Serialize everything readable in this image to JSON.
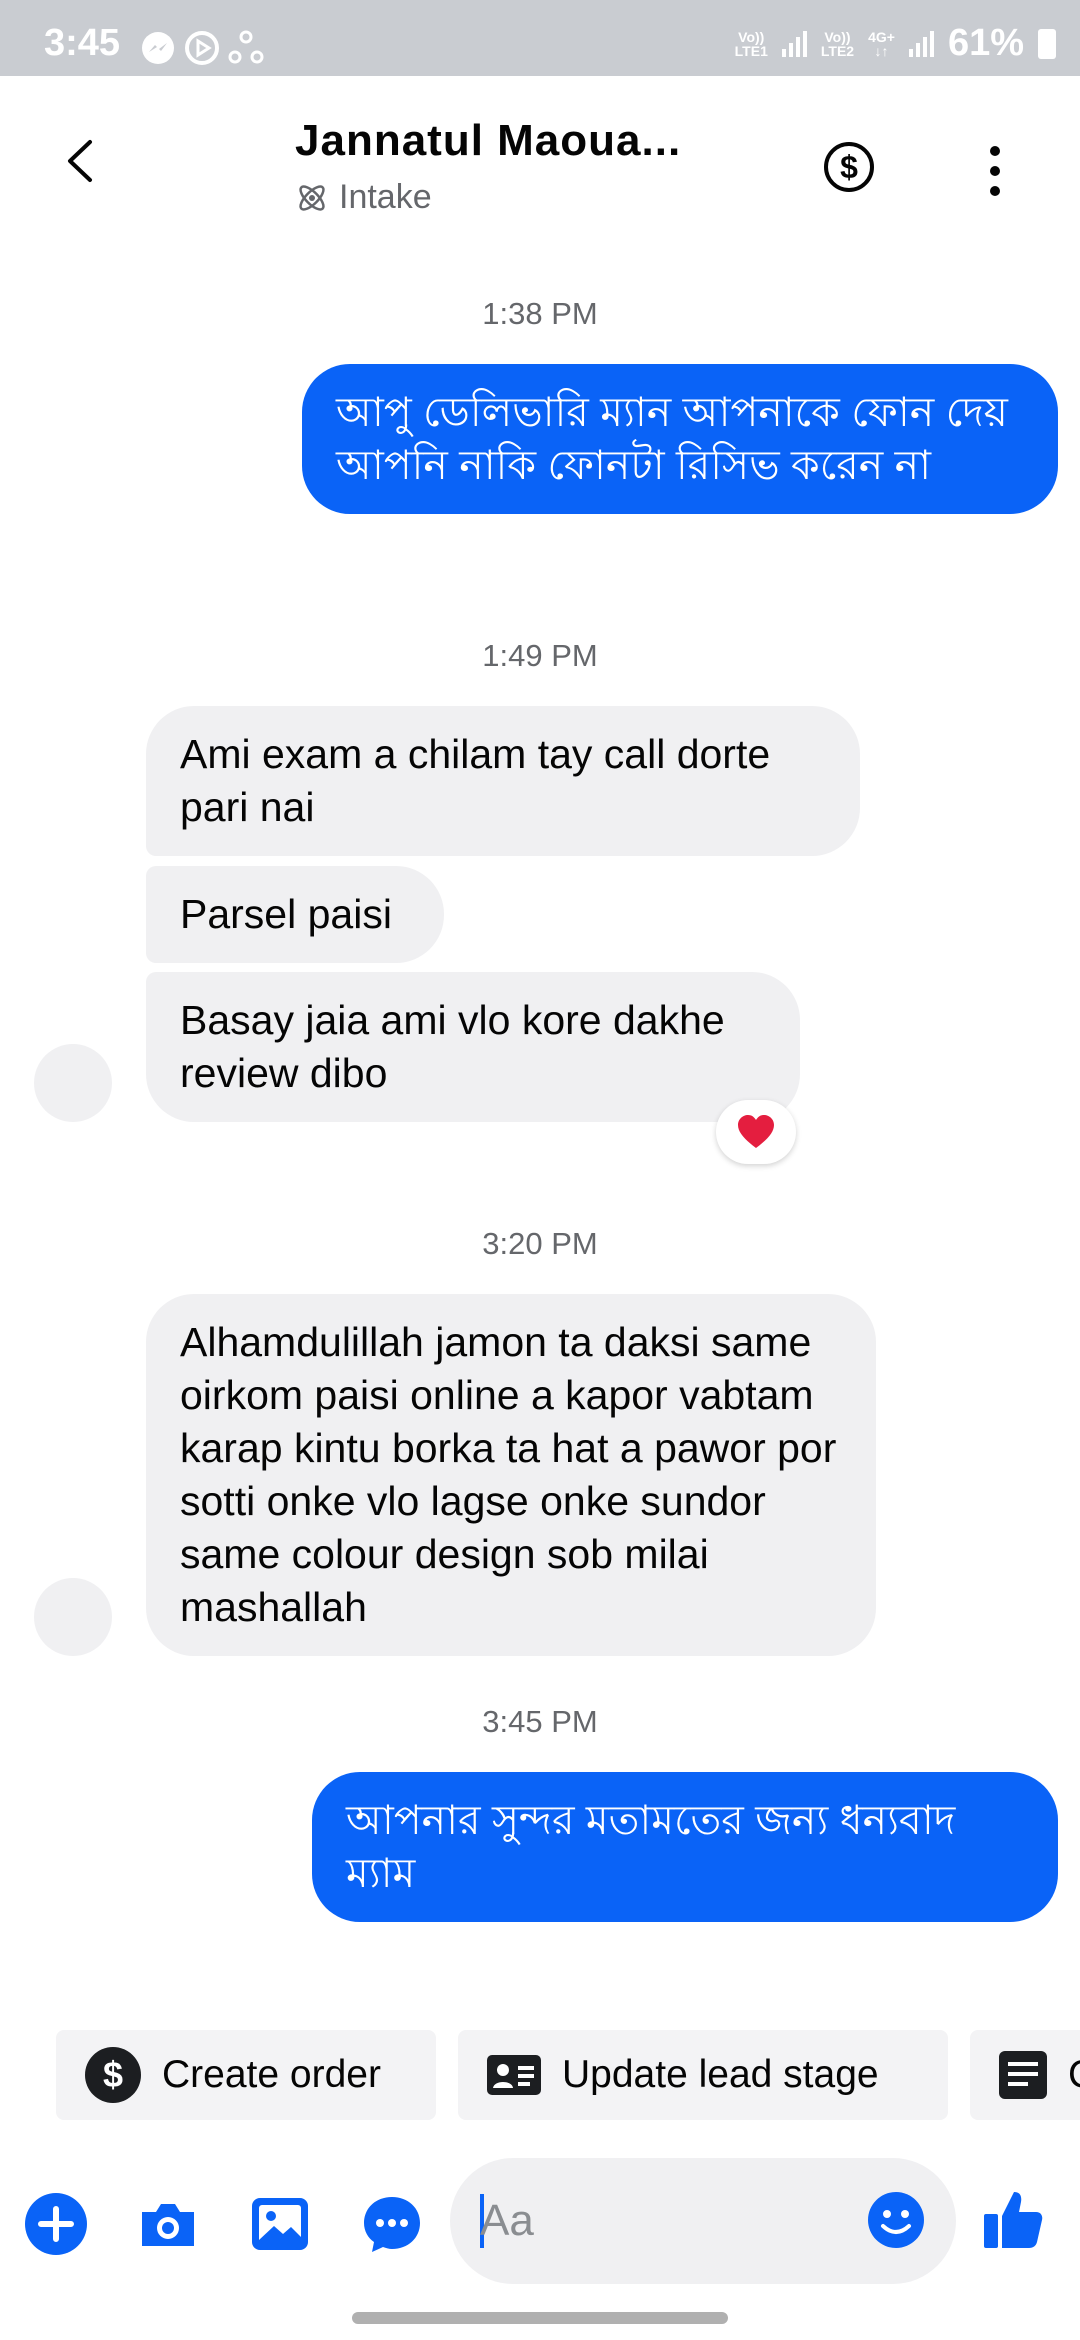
{
  "status_bar": {
    "time": "3:45",
    "net1_top": "Vo))",
    "net1_bottom": "LTE1",
    "net2_top": "Vo))",
    "net2_bottom": "LTE2",
    "net3_top": "4G+",
    "net3_bottom": "↓↑",
    "battery": "61%"
  },
  "header": {
    "title": "Jannatul Maoua...",
    "subtitle": "Intake"
  },
  "messages": [
    {
      "time": "1:38 PM"
    },
    {
      "text": "আপু ডেলিভারি ম্যান আপনাকে ফোন দেয় আপনি নাকি ফোনটা রিসিভ করেন না"
    },
    {
      "time": "1:49 PM"
    },
    {
      "text": "Ami exam a chilam tay call dorte pari nai"
    },
    {
      "text": "Parsel paisi"
    },
    {
      "text": "Basay jaia ami vlo kore dakhe review dibo",
      "reaction": "heart"
    },
    {
      "time": "3:20 PM"
    },
    {
      "text": "Alhamdulillah jamon ta daksi same oirkom paisi online a kapor vabtam karap kintu borka ta hat a pawor por sotti onke vlo lagse onke sundor same colour design sob milai mashallah"
    },
    {
      "time": "3:45 PM"
    },
    {
      "text": "আপনার সুন্দর মতামতের জন্য ধন্যবাদ ম্যাম"
    }
  ],
  "quick_actions": {
    "create_order": "Create order",
    "update_lead_stage": "Update lead stage",
    "third": "C"
  },
  "composer": {
    "placeholder": "Aa"
  },
  "colors": {
    "accent": "#0a63f7",
    "incoming_bubble": "#f0f0f2",
    "reaction_heart": "#e41e3f"
  }
}
